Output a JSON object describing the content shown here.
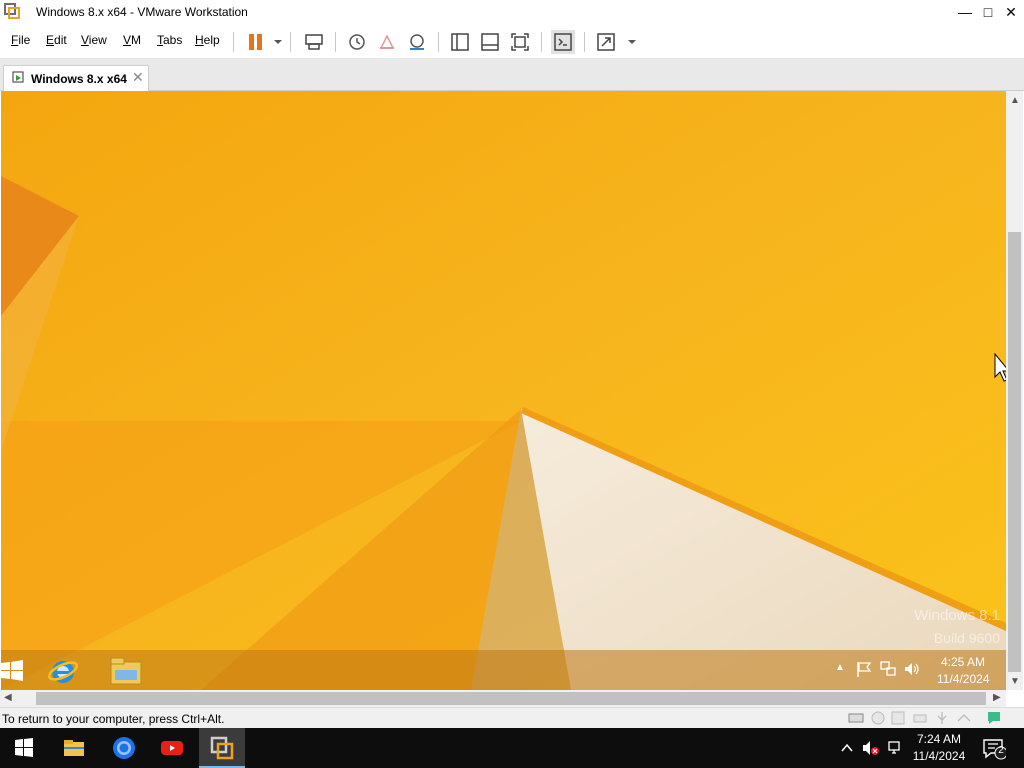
{
  "window": {
    "title": "Windows 8.x x64 - VMware Workstation",
    "minimize": "—",
    "maximize": "□",
    "close": "✕"
  },
  "menu": {
    "file": "File",
    "edit": "Edit",
    "view": "View",
    "vm": "VM",
    "tabs": "Tabs",
    "help": "Help"
  },
  "tab": {
    "label": "Windows 8.x x64",
    "close": "✕"
  },
  "guest": {
    "watermark_line1": "Windows 8.1",
    "watermark_line2": "Build 9600",
    "time": "4:25 AM",
    "date": "11/4/2024"
  },
  "status": {
    "message": "To return to your computer, press Ctrl+Alt."
  },
  "host": {
    "time": "7:24 AM",
    "date": "11/4/2024",
    "notification_count": "2"
  },
  "colors": {
    "wallpaper_orange": "#f5b21a",
    "pause_orange": "#e8731c",
    "host_taskbar": "#0d0d0d"
  }
}
